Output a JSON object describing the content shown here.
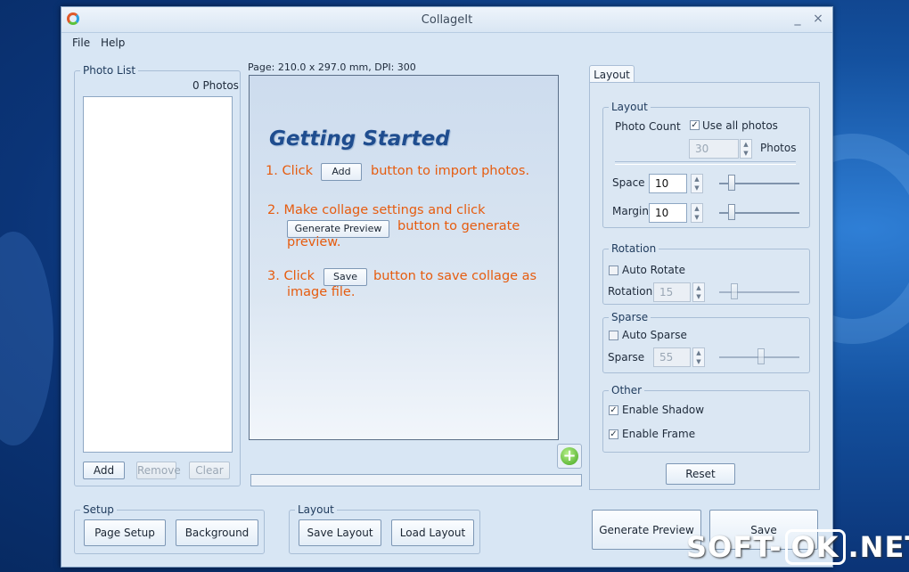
{
  "window": {
    "title": "CollageIt",
    "minimize": "_",
    "close": "×"
  },
  "menu": {
    "file": "File",
    "help": "Help"
  },
  "photo_list": {
    "legend": "Photo List",
    "count": "0 Photos",
    "add": "Add",
    "remove": "Remove",
    "clear": "Clear"
  },
  "page_info": "Page: 210.0 x 297.0 mm, DPI: 300",
  "getting_started": {
    "title": "Getting Started",
    "step1_a": "1. Click",
    "step1_btn": "Add",
    "step1_b": "button to import photos.",
    "step2_a": "2. Make collage settings and click",
    "step2_btn": "Generate Preview",
    "step2_b": "button to generate",
    "step2_c": "preview.",
    "step3_a": "3. Click",
    "step3_btn": "Save",
    "step3_b": "button to save collage as",
    "step3_c": "image file."
  },
  "tab": {
    "layout": "Layout"
  },
  "layout_group": {
    "legend": "Layout",
    "photo_count": "Photo Count",
    "use_all": "Use all photos",
    "use_all_checked": true,
    "count_value": "30",
    "photos": "Photos",
    "space_label": "Space",
    "space_value": "10",
    "margin_label": "Margin",
    "margin_value": "10"
  },
  "rotation_group": {
    "legend": "Rotation",
    "auto_rotate": "Auto Rotate",
    "auto_rotate_checked": false,
    "label": "Rotation",
    "value": "15"
  },
  "sparse_group": {
    "legend": "Sparse",
    "auto_sparse": "Auto Sparse",
    "auto_sparse_checked": false,
    "label": "Sparse",
    "value": "55"
  },
  "other_group": {
    "legend": "Other",
    "shadow": "Enable Shadow",
    "shadow_checked": true,
    "frame": "Enable Frame",
    "frame_checked": true
  },
  "reset": "Reset",
  "setup_group": {
    "legend": "Setup",
    "page_setup": "Page Setup",
    "background": "Background"
  },
  "layout_bottom": {
    "legend": "Layout",
    "save_layout": "Save Layout",
    "load_layout": "Load Layout"
  },
  "actions": {
    "generate_preview": "Generate Preview",
    "save": "Save"
  },
  "watermark": {
    "part1": "SOFT-",
    "part2": "OK",
    "part3": ".NET"
  },
  "icons": {
    "add_photo": "plus-circle-icon",
    "checkmark": "✓"
  }
}
